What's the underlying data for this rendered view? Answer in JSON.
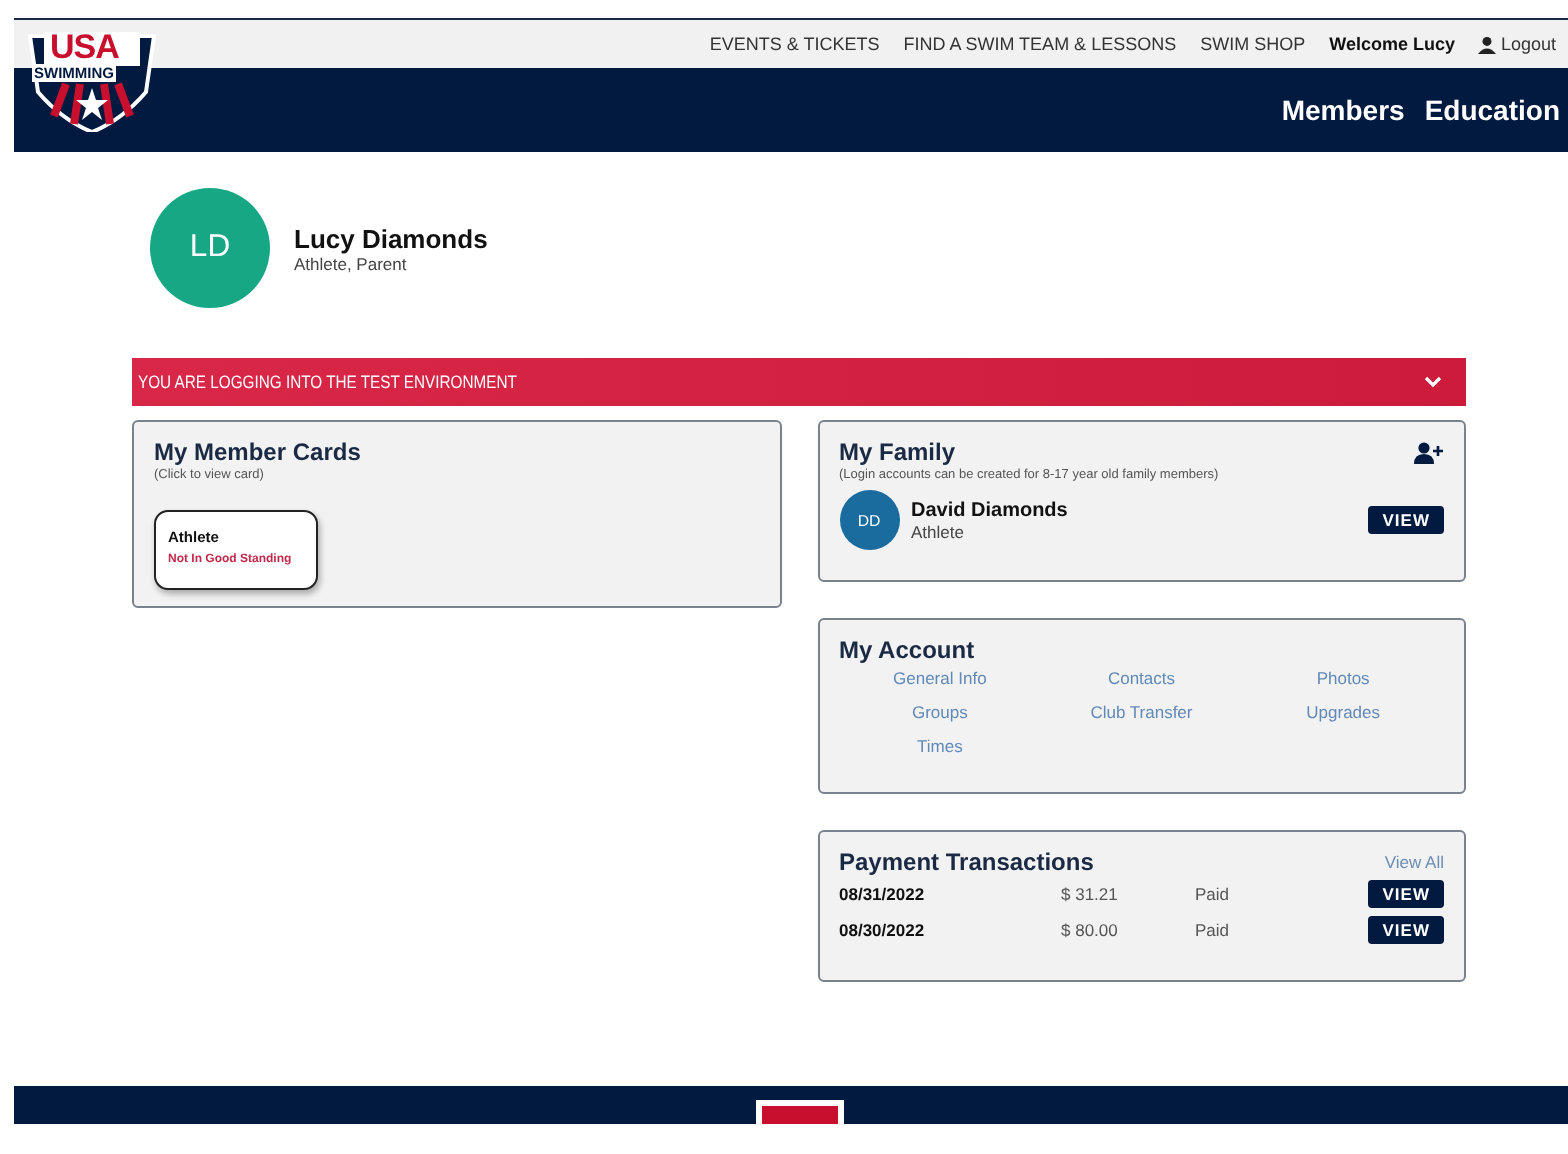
{
  "logo": {
    "top": "USA",
    "bottom": "SWIMMING"
  },
  "top_nav": {
    "links": [
      "EVENTS & TICKETS",
      "FIND A SWIM TEAM & LESSONS",
      "SWIM SHOP"
    ],
    "welcome": "Welcome Lucy",
    "logout": "Logout"
  },
  "main_nav": [
    "Members",
    "Education"
  ],
  "profile": {
    "initials": "LD",
    "name": "Lucy Diamonds",
    "roles": "Athlete, Parent"
  },
  "alert": {
    "text": "YOU ARE LOGGING INTO THE TEST ENVIRONMENT",
    "expanded": false
  },
  "member_cards": {
    "title": "My Member Cards",
    "hint": "(Click to view card)",
    "cards": [
      {
        "type": "Athlete",
        "status": "Not In Good Standing"
      }
    ]
  },
  "family": {
    "title": "My Family",
    "hint": "(Login accounts can be created for 8-17 year old family members)",
    "members": [
      {
        "initials": "DD",
        "name": "David Diamonds",
        "role": "Athlete",
        "button": "VIEW"
      }
    ]
  },
  "account": {
    "title": "My Account",
    "links": [
      "General Info",
      "Contacts",
      "Photos",
      "Groups",
      "Club Transfer",
      "Upgrades",
      "Times"
    ]
  },
  "payments": {
    "title": "Payment Transactions",
    "view_all": "View All",
    "rows": [
      {
        "date": "08/31/2022",
        "amount": "$ 31.21",
        "status": "Paid",
        "button": "VIEW"
      },
      {
        "date": "08/30/2022",
        "amount": "$ 80.00",
        "status": "Paid",
        "button": "VIEW"
      }
    ]
  }
}
